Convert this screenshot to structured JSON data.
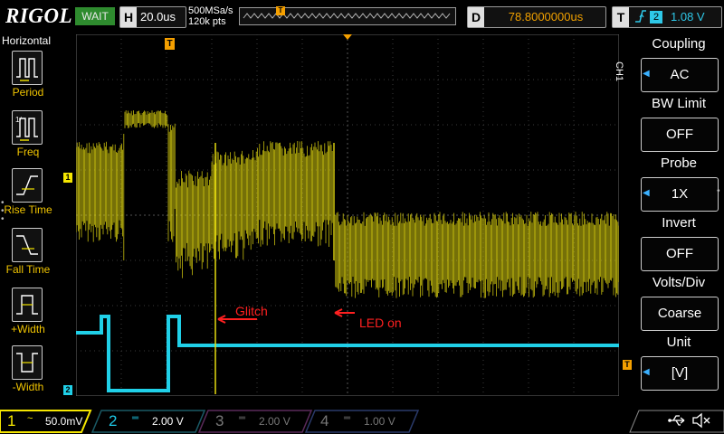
{
  "topbar": {
    "logo": "RIGOL",
    "run_status": "WAIT",
    "timebase": {
      "tag": "H",
      "value": "20.0us"
    },
    "sample_rate": "500MSa/s",
    "memory_depth": "120k pts",
    "trigger_pos_marker": "T",
    "delay": {
      "tag": "D",
      "value": "78.8000000us"
    },
    "trigger": {
      "tag": "T",
      "edge_icon": "rising-edge-icon",
      "source": "2",
      "level": "1.08 V"
    }
  },
  "left_menu": {
    "title": "Horizontal",
    "items": [
      {
        "label": "Period",
        "icon": "period-icon"
      },
      {
        "label": "Freq",
        "icon": "freq-icon"
      },
      {
        "label": "Rise Time",
        "icon": "rise-time-icon"
      },
      {
        "label": "Fall Time",
        "icon": "fall-time-icon"
      },
      {
        "label": "+Width",
        "icon": "pos-width-icon"
      },
      {
        "label": "-Width",
        "icon": "neg-width-icon"
      }
    ]
  },
  "right_menu": {
    "channel_label": "CH1",
    "items": [
      {
        "header": "Coupling",
        "value": "AC",
        "arrow": true
      },
      {
        "header": "BW Limit",
        "value": "OFF",
        "arrow": false
      },
      {
        "header": "Probe",
        "value": "1X",
        "arrow": true
      },
      {
        "header": "Invert",
        "value": "OFF",
        "arrow": false
      },
      {
        "header": "Volts/Div",
        "value": "Coarse",
        "arrow": false
      },
      {
        "header": "Unit",
        "value": "[V]",
        "arrow": true
      }
    ]
  },
  "annotations": {
    "glitch": "Glitch",
    "led_on": "LED on"
  },
  "markers": {
    "ch1": "1",
    "ch2": "2",
    "trigger_level": "T",
    "trigger_top": "T"
  },
  "bottombar": {
    "channels": [
      {
        "num": "1",
        "scale": "50.0mV",
        "coupling_icon": "ac-coupling-icon",
        "color": "#f5e600",
        "active": true
      },
      {
        "num": "2",
        "scale": "2.00 V",
        "coupling_icon": "dc-coupling-icon",
        "color": "#1ec8e6",
        "active": false
      },
      {
        "num": "3",
        "scale": "2.00 V",
        "coupling_icon": "dc-coupling-icon",
        "color": "#c040c0",
        "active": false
      },
      {
        "num": "4",
        "scale": "1.00 V",
        "coupling_icon": "dc-coupling-icon",
        "color": "#3a7aff",
        "active": false
      }
    ],
    "usb_icon": "usb-icon",
    "sound_icon": "speaker-muted-icon"
  },
  "colors": {
    "ch1": "#e6dc10",
    "ch2": "#20d0e8",
    "accent": "#f5a000",
    "annotation": "#ff2020"
  }
}
